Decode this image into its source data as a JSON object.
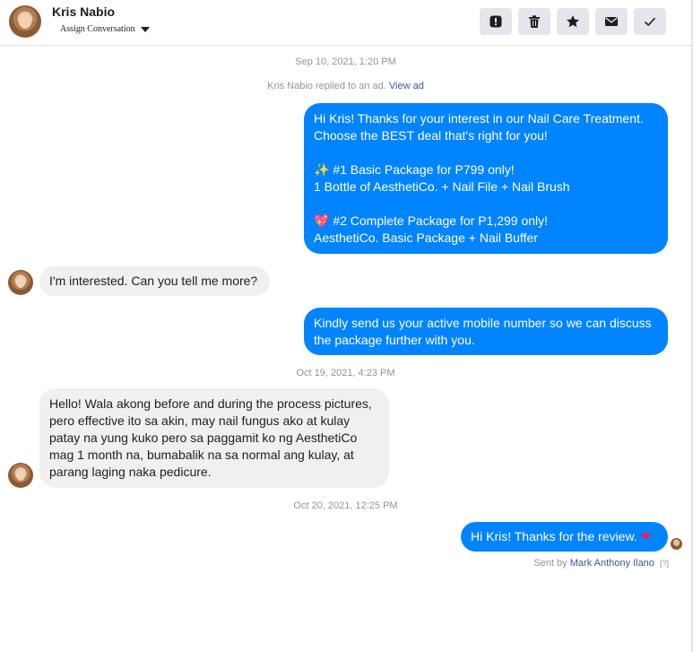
{
  "header": {
    "contact_name": "Kris Nabio",
    "assign_label": "Assign Conversation",
    "actions": [
      {
        "name": "report-icon"
      },
      {
        "name": "trash-icon"
      },
      {
        "name": "star-icon"
      },
      {
        "name": "mail-icon"
      },
      {
        "name": "check-icon"
      }
    ]
  },
  "thread": {
    "ts1": "Sep 10, 2021, 1:20 PM",
    "ad_note": "Kris Nabio replied to an ad.",
    "ad_link": "View ad",
    "msg1": {
      "line1": "Hi Kris! Thanks for your interest in our Nail Care Treatment.",
      "line2": "Choose the BEST deal that's right for you!",
      "emoji1": "✨",
      "line3": " #1 Basic Package for P799 only!",
      "line4": "1 Bottle of AesthetiCo. + Nail File + Nail Brush",
      "emoji2": "💖",
      "line5": " #2 Complete Package for P1,299 only!",
      "line6": "AesthetiCo. Basic Package + Nail Buffer"
    },
    "msg2": "I'm interested. Can you tell me more?",
    "msg3": "Kindly send us your active mobile number so we can discuss the package further with you.",
    "ts2": "Oct 19, 2021, 4:23 PM",
    "msg4": "Hello! Wala akong before and during the process pictures, pero effective ito sa akin, may nail fungus ako at kulay patay na yung kuko pero sa paggamit ko ng AesthetiCo mag 1 month na, bumabalik na sa normal ang kulay, at parang laging naka pedicure.",
    "ts3": "Oct 20, 2021, 12:25 PM",
    "msg5": "Hi Kris! Thanks for the review.",
    "msg5_emoji": "❤",
    "sent_by_label": "Sent by",
    "sent_by_agent": "Mark Anthony Ilano",
    "help_mark": "[?]"
  }
}
